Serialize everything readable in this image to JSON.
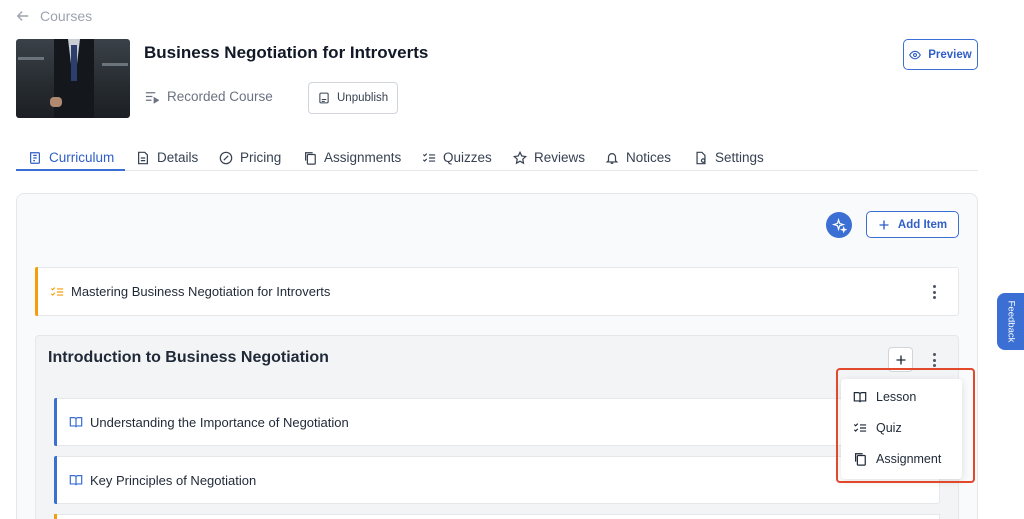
{
  "nav": {
    "back_label": "Courses"
  },
  "course": {
    "title": "Business Negotiation for Introverts",
    "type_label": "Recorded Course",
    "unpublish_label": "Unpublish",
    "preview_label": "Preview",
    "thumbnail_icon": "businessman-photo"
  },
  "tabs": [
    {
      "label": "Curriculum",
      "icon": "curriculum-icon",
      "active": true
    },
    {
      "label": "Details",
      "icon": "document-icon"
    },
    {
      "label": "Pricing",
      "icon": "pricing-icon"
    },
    {
      "label": "Assignments",
      "icon": "copy-icon"
    },
    {
      "label": "Quizzes",
      "icon": "checklist-icon"
    },
    {
      "label": "Reviews",
      "icon": "star-icon"
    },
    {
      "label": "Notices",
      "icon": "bell-icon"
    },
    {
      "label": "Settings",
      "icon": "settings-file-icon"
    }
  ],
  "toolbar": {
    "add_item_label": "Add Item"
  },
  "quiz_row": {
    "label": "Mastering Business Negotiation for Introverts",
    "accent": "#f59e0b"
  },
  "section": {
    "title": "Introduction to Business Negotiation",
    "lessons": [
      {
        "label": "Understanding the Importance of Negotiation",
        "accent": "#3b6fd4"
      },
      {
        "label": "Key Principles of Negotiation",
        "accent": "#3b6fd4"
      }
    ]
  },
  "add_menu": {
    "items": [
      {
        "label": "Lesson",
        "icon": "book-icon"
      },
      {
        "label": "Quiz",
        "icon": "checklist-icon"
      },
      {
        "label": "Assignment",
        "icon": "copy-icon"
      }
    ]
  },
  "feedback_label": "Feedback",
  "colors": {
    "accent": "#3b6fd4",
    "highlight": "#e2482c",
    "quiz_accent": "#f59e0b"
  }
}
